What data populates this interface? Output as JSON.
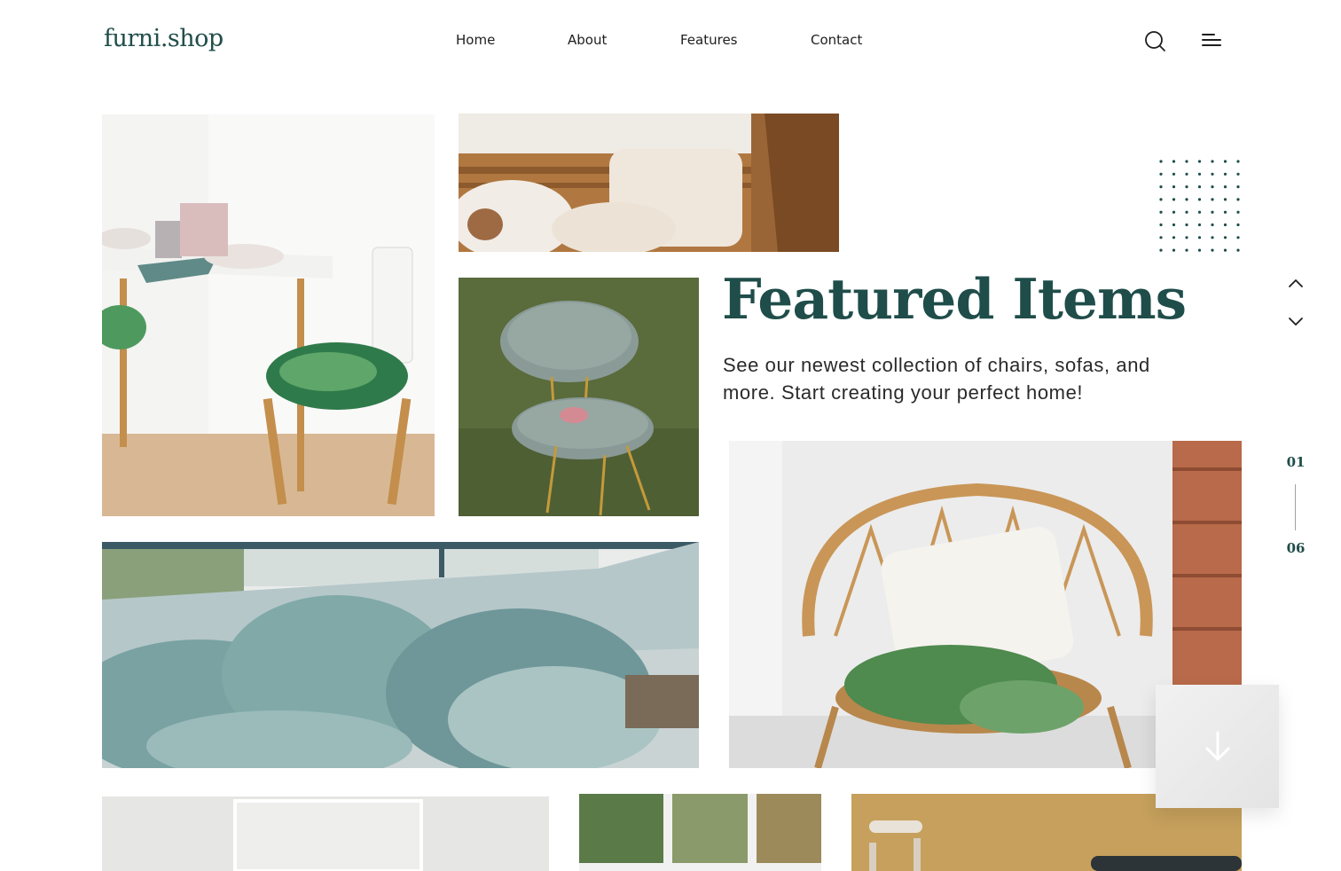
{
  "header": {
    "logo": "furni.shop",
    "nav": [
      {
        "label": "Home"
      },
      {
        "label": "About"
      },
      {
        "label": "Features"
      },
      {
        "label": "Contact"
      }
    ],
    "icons": [
      "search-icon",
      "menu-icon"
    ]
  },
  "hero": {
    "title": "Featured Items",
    "description": "See our newest collection of chairs, sofas, and more. Start creating your perfect home!"
  },
  "slider": {
    "current": "01",
    "total": "06",
    "icons": [
      "chevron-up-icon",
      "chevron-down-icon",
      "arrow-down-icon"
    ]
  },
  "colors": {
    "brand": "#1f4d4a",
    "text": "#1e1e1e",
    "background": "#ffffff"
  }
}
